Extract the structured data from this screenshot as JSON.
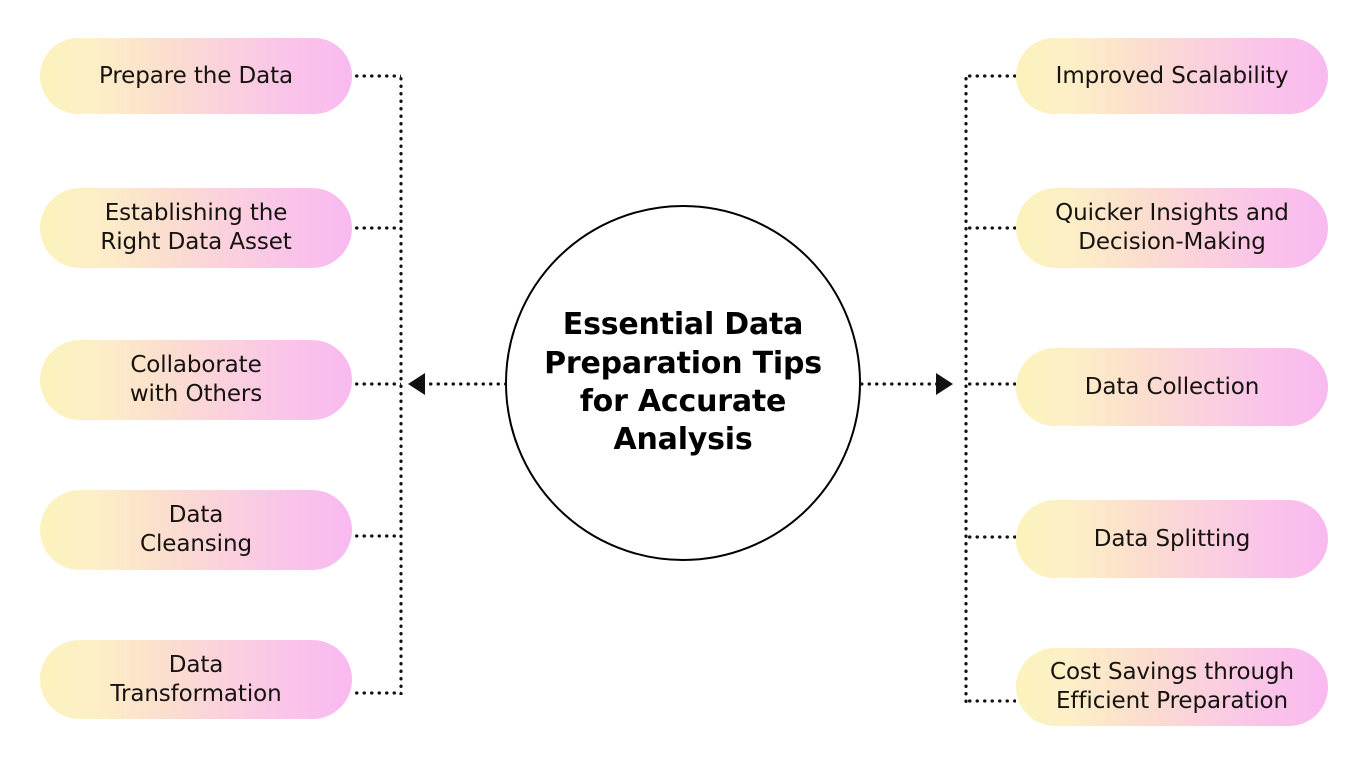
{
  "diagram": {
    "type": "mind-map",
    "center": {
      "label": "Essential Data\nPreparation Tips\nfor Accurate\nAnalysis"
    },
    "colors": {
      "pill_gradient_start": "#fbf2bc",
      "pill_gradient_end": "#f9b9f0",
      "connector": "#111111",
      "circle_stroke": "#000000",
      "text": "#16120f",
      "background": "#ffffff"
    },
    "left_branch": {
      "arrow_direction": "left",
      "items": [
        {
          "label": "Prepare the Data"
        },
        {
          "label": "Establishing the\nRight Data Asset"
        },
        {
          "label": "Collaborate\nwith Others"
        },
        {
          "label": "Data\nCleansing"
        },
        {
          "label": "Data\nTransformation"
        }
      ]
    },
    "right_branch": {
      "arrow_direction": "right",
      "items": [
        {
          "label": "Improved Scalability"
        },
        {
          "label": "Quicker Insights and\nDecision-Making"
        },
        {
          "label": "Data Collection"
        },
        {
          "label": "Data Splitting"
        },
        {
          "label": "Cost Savings through\nEfficient Preparation"
        }
      ]
    }
  }
}
